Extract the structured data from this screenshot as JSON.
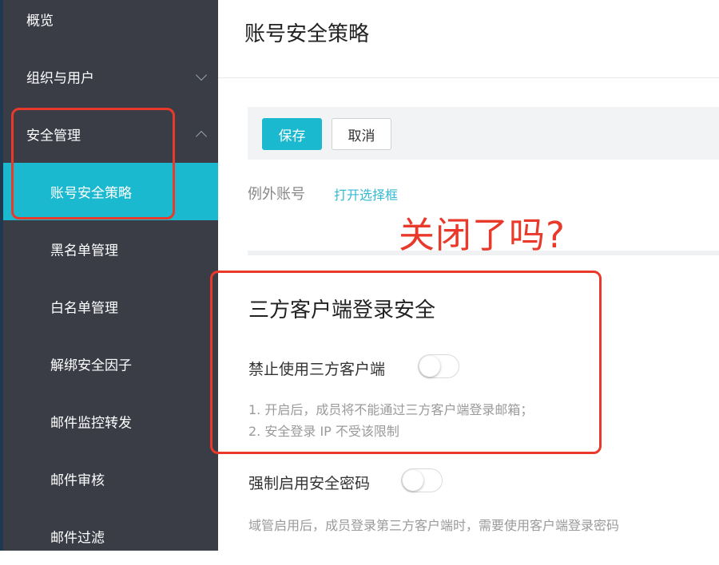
{
  "sidebar": {
    "items": [
      {
        "label": "概览"
      },
      {
        "label": "组织与用户"
      },
      {
        "label": "安全管理"
      },
      {
        "label": "账号安全策略"
      },
      {
        "label": "黑名单管理"
      },
      {
        "label": "白名单管理"
      },
      {
        "label": "解绑安全因子"
      },
      {
        "label": "邮件监控转发"
      },
      {
        "label": "邮件审核"
      },
      {
        "label": "邮件过滤"
      }
    ]
  },
  "main": {
    "title": "账号安全策略",
    "toolbar": {
      "save_label": "保存",
      "cancel_label": "取消"
    },
    "exception": {
      "label": "例外账号",
      "link": "打开选择框"
    },
    "annotation": "关闭了吗?",
    "section": {
      "title": "三方客户端登录安全",
      "toggle1_label": "禁止使用三方客户端",
      "toggle1_on": false,
      "desc1_line1": "1. 开启后，成员将不能通过三方客户端登录邮箱；",
      "desc1_line2": "2. 安全登录 IP 不受该限制",
      "toggle2_label": "强制启用安全密码",
      "toggle2_on": false,
      "desc2": "域管启用后，成员登录第三方客户端时，需要使用客户端登录密码"
    }
  },
  "colors": {
    "accent": "#1ab9cf",
    "sidebar_bg": "#3a3d46",
    "annotation_red": "#e8392b",
    "link": "#35b9d3"
  }
}
